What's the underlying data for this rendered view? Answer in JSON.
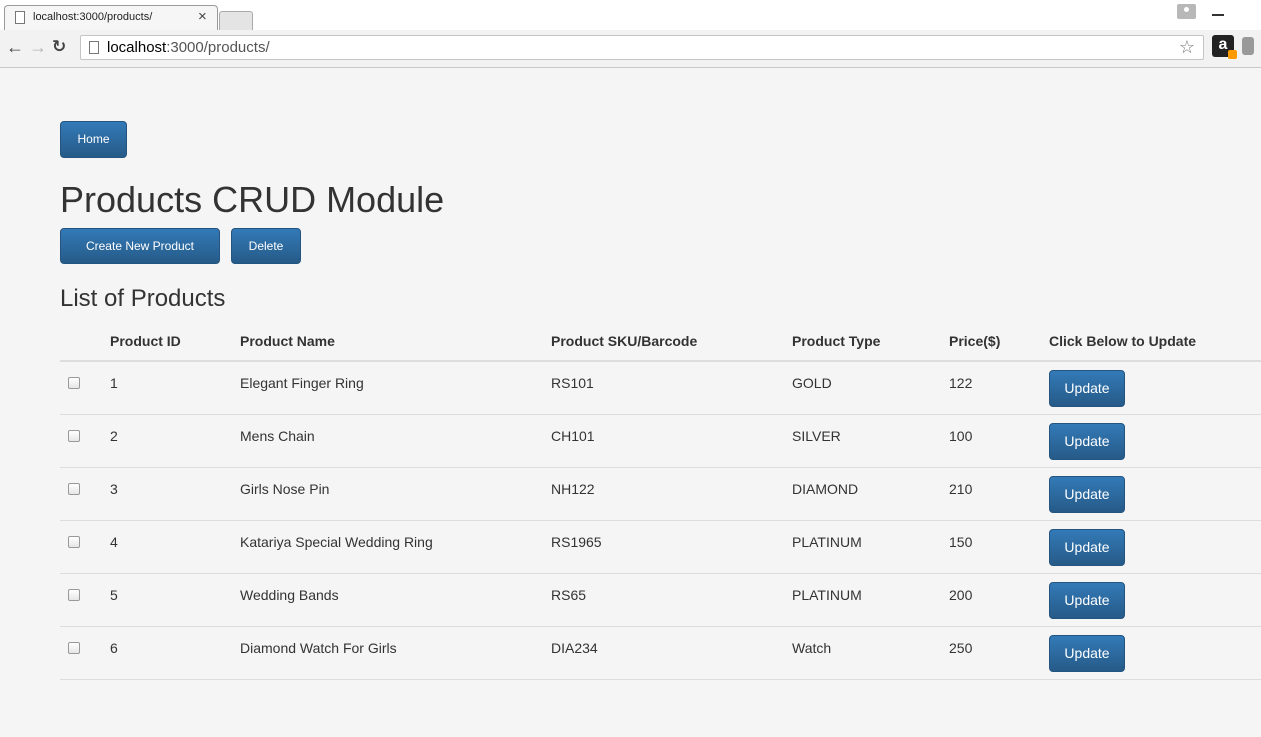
{
  "browser": {
    "tab_title": "localhost:3000/products/",
    "tab_close": "×",
    "url_host": "localhost",
    "url_rest": ":3000/products/"
  },
  "page": {
    "home_label": "Home",
    "title": "Products CRUD Module",
    "create_label": "Create New Product",
    "delete_label": "Delete",
    "list_title": "List of Products"
  },
  "table": {
    "headers": [
      "Product ID",
      "Product Name",
      "Product SKU/Barcode",
      "Product Type",
      "Price($)",
      "Click Below to Update"
    ],
    "rows": [
      {
        "id": "1",
        "name": "Elegant Finger Ring",
        "sku": "RS101",
        "type": "GOLD",
        "price": "122",
        "action": "Update"
      },
      {
        "id": "2",
        "name": "Mens Chain",
        "sku": "CH101",
        "type": "SILVER",
        "price": "100",
        "action": "Update"
      },
      {
        "id": "3",
        "name": "Girls Nose Pin",
        "sku": "NH122",
        "type": "DIAMOND",
        "price": "210",
        "action": "Update"
      },
      {
        "id": "4",
        "name": "Katariya Special Wedding Ring",
        "sku": "RS1965",
        "type": "PLATINUM",
        "price": "150",
        "action": "Update"
      },
      {
        "id": "5",
        "name": "Wedding Bands",
        "sku": "RS65",
        "type": "PLATINUM",
        "price": "200",
        "action": "Update"
      },
      {
        "id": "6",
        "name": "Diamond Watch For Girls",
        "sku": "DIA234",
        "type": "Watch",
        "price": "250",
        "action": "Update"
      }
    ]
  },
  "colors": {
    "primary_button": "#337ab7",
    "page_background": "#f5f5f5",
    "row_divider": "#dddddd"
  },
  "icons": [
    "page-icon",
    "close-icon",
    "back-arrow-icon",
    "forward-arrow-icon",
    "reload-icon",
    "star-icon",
    "amazon-icon",
    "profile-icon",
    "minimize-icon",
    "checkbox-icon"
  ]
}
